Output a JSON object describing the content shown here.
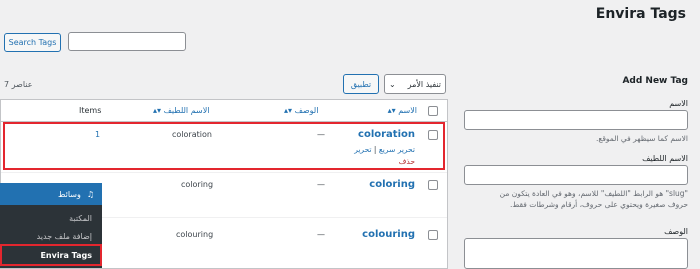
{
  "page": {
    "title": "Envira Tags"
  },
  "search": {
    "button_label": "Search Tags",
    "placeholder": ""
  },
  "add_form": {
    "heading": "Add New Tag",
    "name_label": "الاسم",
    "name_help": "الاسم كما سيظهر في الموقع.",
    "slug_label": "الاسم اللطيف",
    "slug_help_1": "\"slug\" هو الرابط \"اللطيف\" للاسم، وهو في العادة يتكون من",
    "slug_help_2": "حروف صغيرة ويحتوي على حروف، أرقام وشرطات فقط.",
    "desc_label": "الوصف"
  },
  "bulk": {
    "select_label": "تنفيذ الأمر",
    "apply_label": "تطبيق",
    "items_count": "7 عناصر"
  },
  "table": {
    "headers": {
      "name": "الاسم",
      "description": "الوصف",
      "slug": "الاسم اللطيف",
      "count": "Items"
    },
    "rows": [
      {
        "name": "coloration",
        "description": "—",
        "slug": "coloration",
        "count": "1",
        "actions": {
          "edit": "تحرير",
          "quick_edit": "تحرير سريع",
          "delete": "حذف",
          "sep": "|"
        }
      },
      {
        "name": "coloring",
        "description": "—",
        "slug": "coloring",
        "count": ""
      },
      {
        "name": "colouring",
        "description": "—",
        "slug": "colouring",
        "count": ""
      }
    ]
  },
  "admin_menu": {
    "section": "وسائط",
    "items": [
      "المكتبة",
      "إضافة ملف جديد",
      "Envira Tags"
    ]
  },
  "colors": {
    "accent": "#2271b1",
    "highlight": "#e3262e",
    "menu_bg": "#2c3338"
  }
}
